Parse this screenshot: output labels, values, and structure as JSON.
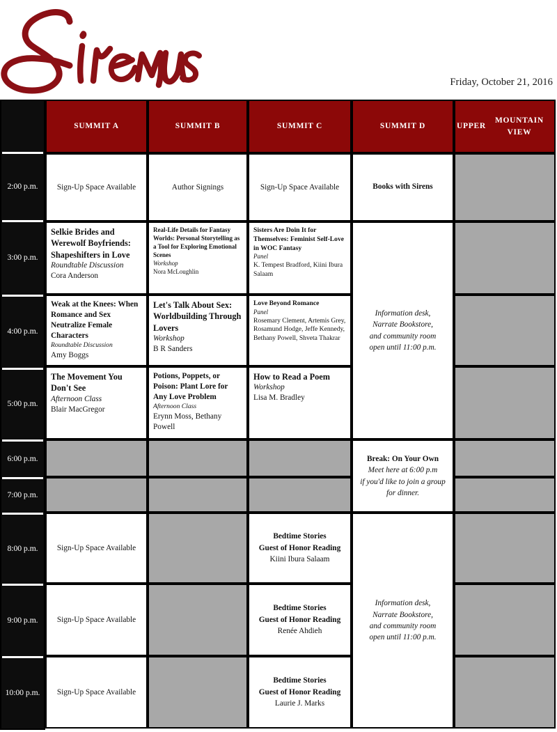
{
  "masthead": {
    "logo_text": "Sirens",
    "logo_color": "#8B1015",
    "date": "Friday, October 21, 2016"
  },
  "theme": {
    "header_red": "#8C0808",
    "unavailable_gray": "#A8A8A8",
    "time_rail_black": "#0D0D0D",
    "grid_line": "#000000",
    "text": "#111111"
  },
  "columns": [
    {
      "key": "time",
      "label": ""
    },
    {
      "key": "summit_a",
      "label": "SUMMIT A"
    },
    {
      "key": "summit_b",
      "label": "SUMMIT B"
    },
    {
      "key": "summit_c",
      "label": "SUMMIT C"
    },
    {
      "key": "summit_d",
      "label": "SUMMIT D"
    },
    {
      "key": "upper_mountain_view",
      "label": "UPPER MOUNTAIN VIEW"
    }
  ],
  "column_labels": {
    "summit_a": "SUMMIT A",
    "summit_b": "SUMMIT B",
    "summit_c": "SUMMIT C",
    "umv_line1": "UPPER",
    "umv_line2": "MOUNTAIN VIEW",
    "summit_d": "SUMMIT D"
  },
  "times": {
    "t1400": "2:00 p.m.",
    "t1500": "3:00 p.m.",
    "t1600": "4:00 p.m.",
    "t1700": "5:00 p.m.",
    "t1800": "6:00 p.m.",
    "t1900": "7:00 p.m.",
    "t2000": "8:00 p.m.",
    "t2100": "9:00 p.m.",
    "t2200": "10:00 p.m."
  },
  "events": {
    "a_1400": {
      "title": "Sign-Up Space Available"
    },
    "b_1400": {
      "title": "Author Signings"
    },
    "c_1400": {
      "title": "Sign-Up Space Available"
    },
    "d_1400": {
      "title": "Books with Sirens"
    },
    "a_1500": {
      "title": "Selkie Brides and Werewolf Boyfriends: Shapeshifters in Love",
      "kind": "Roundtable Discussion",
      "people": "Cora Anderson"
    },
    "b_1500": {
      "title": "Real-Life Details for Fantasy Worlds: Personal Storytelling as a Tool for Exploring Emotional Scenes",
      "kind": "Workshop",
      "people": "Nora McLoughlin"
    },
    "c_1500": {
      "title": "Sisters Are Doin It for Themselves: Feminist Self-Love in WOC Fantasy",
      "kind": "Panel",
      "people": "K. Tempest Bradford, Kiini Ibura Salaam"
    },
    "a_1600": {
      "title": "Weak at the Knees: When Romance and Sex Neutralize Female Characters",
      "kind": "Roundtable Discussion",
      "people": "Amy Boggs"
    },
    "b_1600": {
      "title": "Let's Talk About Sex: Worldbuilding Through Lovers",
      "kind": "Workshop",
      "people": "B R Sanders"
    },
    "c_1600": {
      "title": "Love Beyond Romance",
      "kind": "Panel",
      "people": "Rosemary Clement, Artemis Grey, Rosamund Hodge, Jeffe Kennedy, Bethany Powell, Shveta Thakrar"
    },
    "a_1700": {
      "title": "The Movement You Don't See",
      "kind": "Afternoon Class",
      "people": "Blair MacGregor"
    },
    "b_1700": {
      "title": "Potions, Poppets, or Poison: Plant Lore for Any Love Problem",
      "kind": "Afternoon Class",
      "people": "Erynn Moss, Bethany Powell"
    },
    "c_1700": {
      "title": "How to Read a Poem",
      "kind": "Workshop",
      "people": "Lisa M. Bradley"
    },
    "d_1500_1700": {
      "lines": [
        "Information desk,",
        "Narrate Bookstore,",
        "and community room",
        "open until 11:00 p.m."
      ]
    },
    "d_1800_1900": {
      "title": "Break: On Your Own",
      "lines": [
        "Meet here at 6:00 p.m",
        "if you'd like to join a group",
        "for dinner."
      ]
    },
    "a_2000": {
      "title": "Sign-Up Space Available"
    },
    "c_2000": {
      "line1": "Bedtime Stories",
      "line2": "Guest of Honor Reading",
      "people": "Kiini Ibura Salaam"
    },
    "a_2100": {
      "title": "Sign-Up Space Available"
    },
    "c_2100": {
      "line1": "Bedtime Stories",
      "line2": "Guest of Honor Reading",
      "people": "Renée Ahdieh"
    },
    "a_2200": {
      "title": "Sign-Up Space Available"
    },
    "c_2200": {
      "line1": "Bedtime Stories",
      "line2": "Guest of Honor Reading",
      "people": "Laurie J. Marks"
    },
    "d_2000_2200": {
      "lines": [
        "Information desk,",
        "Narrate Bookstore,",
        "and community room",
        "open until 11:00 p.m."
      ]
    }
  }
}
